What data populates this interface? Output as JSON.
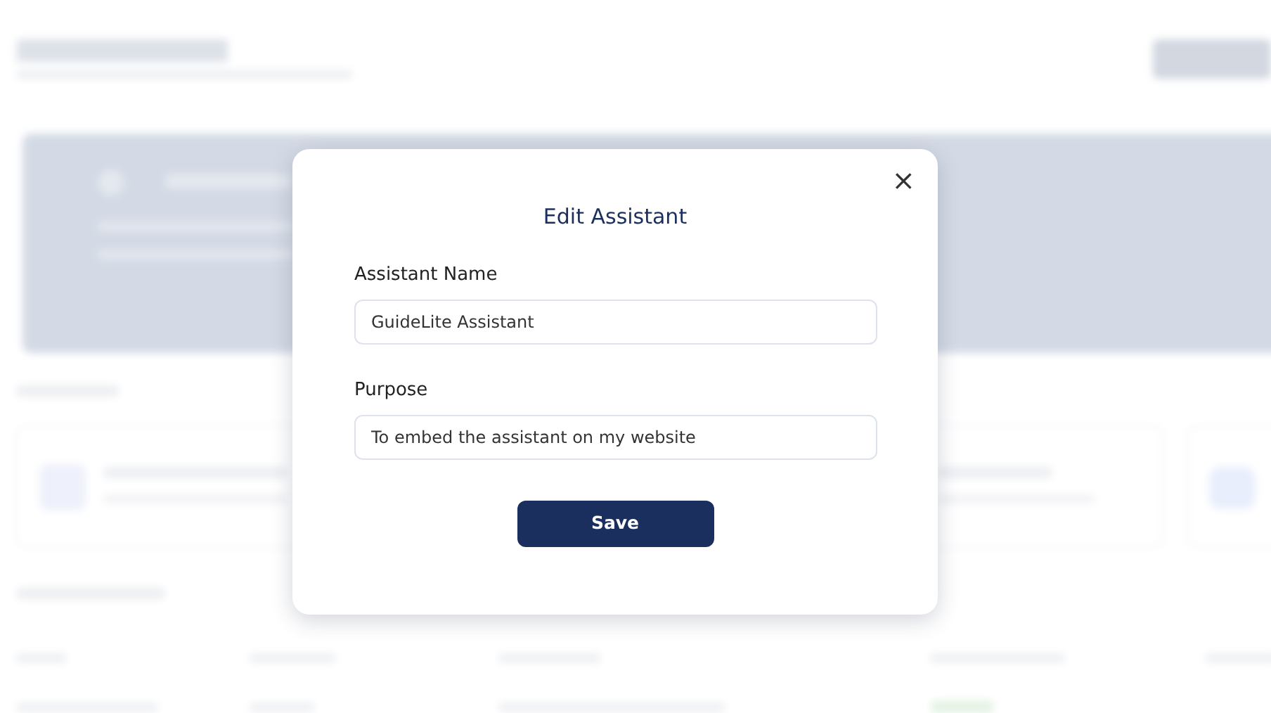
{
  "dialog": {
    "title": "Edit Assistant",
    "close": "×",
    "fields": [
      {
        "label": "Assistant Name",
        "value": "GuideLite Assistant"
      },
      {
        "label": "Purpose",
        "value": "To embed the assistant on my website"
      }
    ],
    "button": "Save"
  }
}
